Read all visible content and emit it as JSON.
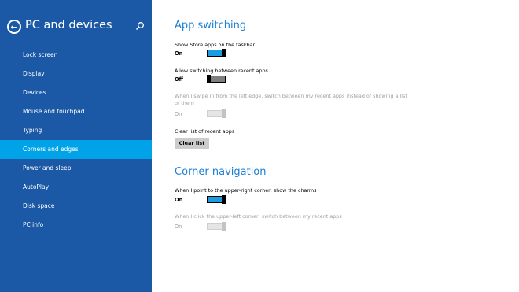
{
  "sidebar": {
    "title": "PC and devices",
    "items": [
      {
        "label": "Lock screen",
        "selected": false
      },
      {
        "label": "Display",
        "selected": false
      },
      {
        "label": "Devices",
        "selected": false
      },
      {
        "label": "Mouse and touchpad",
        "selected": false
      },
      {
        "label": "Typing",
        "selected": false
      },
      {
        "label": "Corners and edges",
        "selected": true
      },
      {
        "label": "Power and sleep",
        "selected": false
      },
      {
        "label": "AutoPlay",
        "selected": false
      },
      {
        "label": "Disk space",
        "selected": false
      },
      {
        "label": "PC info",
        "selected": false
      }
    ]
  },
  "app_switching": {
    "title": "App switching",
    "show_store_apps": {
      "label": "Show Store apps on the taskbar",
      "state": "On"
    },
    "allow_switching": {
      "label": "Allow switching between recent apps",
      "state": "Off"
    },
    "swipe_in": {
      "label": "When I swipe in from the left edge, switch between my recent apps instead of showing a list of them",
      "state": "On"
    },
    "clear_list": {
      "label": "Clear list of recent apps",
      "button": "Clear list"
    }
  },
  "corner_navigation": {
    "title": "Corner navigation",
    "upper_right": {
      "label": "When I point to the upper-right corner, show the charms",
      "state": "On"
    },
    "upper_left": {
      "label": "When I click the upper-left corner, switch between my recent apps",
      "state": "On"
    }
  },
  "colors": {
    "sidebar_bg": "#1b59a6",
    "selected_bg": "#00a2e8",
    "accent": "#1b7fd4",
    "toggle_on": "#1a9de0"
  }
}
